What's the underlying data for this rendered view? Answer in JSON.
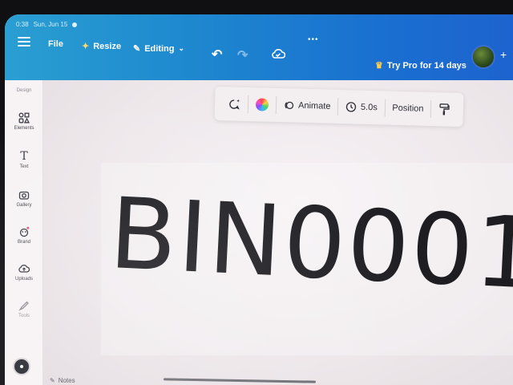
{
  "status_bar": {
    "time": "0:38",
    "date": "Sun, Jun 15"
  },
  "header": {
    "file_label": "File",
    "resize_label": "Resize",
    "editing_label": "Editing",
    "try_pro_label": "Try Pro for 14 days",
    "more_icon": "three-dots-icon"
  },
  "rail": {
    "design_label": "Design",
    "items": [
      {
        "label": "Elements",
        "icon": "elements-icon"
      },
      {
        "label": "Text",
        "icon": "text-icon"
      },
      {
        "label": "Gallery",
        "icon": "camera-icon"
      },
      {
        "label": "Brand",
        "icon": "brand-icon"
      },
      {
        "label": "Uploads",
        "icon": "upload-icon"
      },
      {
        "label": "Tools",
        "icon": "draw-icon"
      }
    ]
  },
  "toolbar": {
    "animate_label": "Animate",
    "duration_label": "5.0s",
    "position_label": "Position"
  },
  "canvas": {
    "text": "BIN0001"
  },
  "footer": {
    "notes_label": "Notes"
  },
  "colors": {
    "header_blue": "#1d86cf",
    "canvas_bg": "#efe9ec"
  }
}
